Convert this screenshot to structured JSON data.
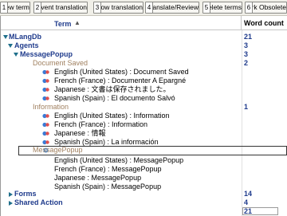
{
  "toolbar": {
    "buttons": [
      {
        "num": "1",
        "label": "New term"
      },
      {
        "num": "2",
        "label": "Prevent translation"
      },
      {
        "num": "3",
        "label": "Allow translation"
      },
      {
        "num": "4",
        "label": "Translate/Review"
      },
      {
        "num": "5",
        "label": "Delete terms"
      },
      {
        "num": "6",
        "label": "Mark Obsolete"
      }
    ]
  },
  "grid": {
    "headers": {
      "term": "Term",
      "word_count": "Word count"
    },
    "rows": [
      {
        "text": "MLangDb",
        "count": "21"
      },
      {
        "text": "Agents",
        "count": "3"
      },
      {
        "text": "MessagePopup",
        "count": "3"
      },
      {
        "text": "Document Saved",
        "count": "2"
      },
      {
        "text": "English (United States) : Document Saved",
        "count": ""
      },
      {
        "text": "French (France) : Documenter A Epargné",
        "count": ""
      },
      {
        "text": "Japanese : 文書は保存されました。",
        "count": ""
      },
      {
        "text": "Spanish (Spain) : El documento Salvó",
        "count": ""
      },
      {
        "text": "Information",
        "count": "1"
      },
      {
        "text": "English (United States) : Information",
        "count": ""
      },
      {
        "text": "French (France) : Information",
        "count": ""
      },
      {
        "text": "Japanese : 情報",
        "count": ""
      },
      {
        "text": "Spanish (Spain) : La información",
        "count": ""
      },
      {
        "text": "MessagePopup",
        "count": ""
      },
      {
        "text": "English (United States) : MessagePopup",
        "count": ""
      },
      {
        "text": "French (France) : MessagePopup",
        "count": ""
      },
      {
        "text": "Japanese : MessagePopup",
        "count": ""
      },
      {
        "text": "Spanish (Spain) : MessagePopup",
        "count": ""
      },
      {
        "text": "Forms",
        "count": "14"
      },
      {
        "text": "Shared Action",
        "count": "4"
      }
    ],
    "total": "21"
  },
  "colors": {
    "accent": "#1f3b8c",
    "key_text": "#a08060",
    "expander": "#1f6f8b"
  }
}
